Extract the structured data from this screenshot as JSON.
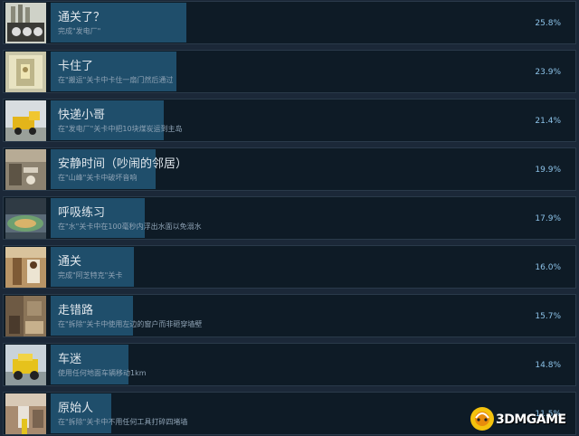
{
  "achievements": [
    {
      "title": "通关了？",
      "desc": "完成\"发电厂\"",
      "pct": "25.8%",
      "percent_value": 25.8,
      "thumb": "power-plant-icon"
    },
    {
      "title": "卡住了",
      "desc": "在\"搬运\"关卡中卡住一扇门然后通过",
      "pct": "23.9%",
      "percent_value": 23.9,
      "thumb": "stuck-door-icon"
    },
    {
      "title": "快递小哥",
      "desc": "在\"发电厂\"关卡中把10块煤炭运到主岛",
      "pct": "21.4%",
      "percent_value": 21.4,
      "thumb": "delivery-truck-icon"
    },
    {
      "title": "安静时间（吵闹的邻居）",
      "desc": "在\"山峰\"关卡中破坏音响",
      "pct": "19.9%",
      "percent_value": 19.9,
      "thumb": "quiet-time-icon"
    },
    {
      "title": "呼吸练习",
      "desc": "在\"水\"关卡中在100毫秒内浮出水面以免溺水",
      "pct": "17.9%",
      "percent_value": 17.9,
      "thumb": "breathing-exercise-icon"
    },
    {
      "title": "通关",
      "desc": "完成\"阿芝特克\"关卡",
      "pct": "16.0%",
      "percent_value": 16.0,
      "thumb": "aztec-icon"
    },
    {
      "title": "走错路",
      "desc": "在\"拆除\"关卡中使用左边的窗户而非砸穿墙壁",
      "pct": "15.7%",
      "percent_value": 15.7,
      "thumb": "wrong-way-icon"
    },
    {
      "title": "车迷",
      "desc": "使用任何地面车辆移动1km",
      "pct": "14.8%",
      "percent_value": 14.8,
      "thumb": "car-fan-icon"
    },
    {
      "title": "原始人",
      "desc": "在\"拆除\"关卡中不用任何工具打碎四堵墙",
      "pct": "11.5%",
      "percent_value": 11.5,
      "thumb": "caveman-icon"
    }
  ],
  "watermark": {
    "text": "3DMGAME"
  }
}
